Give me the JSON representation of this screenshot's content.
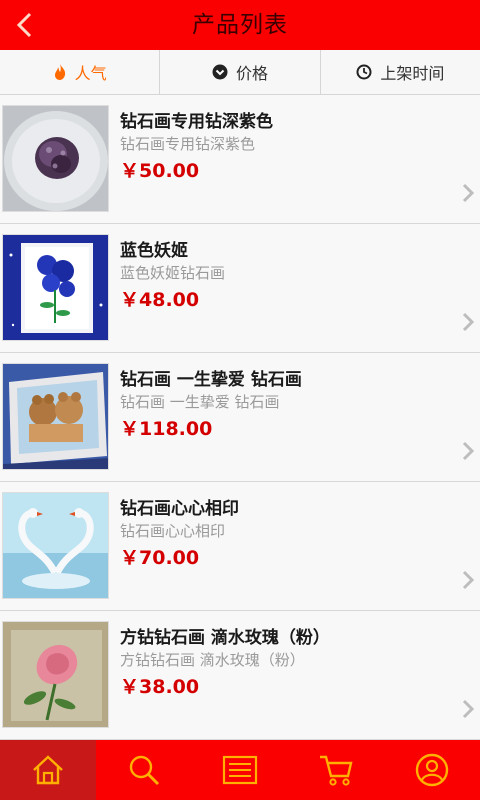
{
  "header": {
    "title": "产品列表"
  },
  "sort_tabs": [
    {
      "label": "人气",
      "icon": "flame-icon",
      "active": true
    },
    {
      "label": "价格",
      "icon": "chevron-down-circle-icon",
      "active": false
    },
    {
      "label": "上架时间",
      "icon": "clock-icon",
      "active": false
    }
  ],
  "products": [
    {
      "name": "钻石画专用钻深紫色",
      "desc": "钻石画专用钻深紫色",
      "price": "￥50.00"
    },
    {
      "name": "蓝色妖姬",
      "desc": "蓝色妖姬钻石画",
      "price": "￥48.00"
    },
    {
      "name": "钻石画 一生挚爱 钻石画",
      "desc": "钻石画 一生挚爱 钻石画",
      "price": "￥118.00"
    },
    {
      "name": "钻石画心心相印",
      "desc": "钻石画心心相印",
      "price": "￥70.00"
    },
    {
      "name": "方钻钻石画 滴水玫瑰（粉）",
      "desc": "方钻钻石画 滴水玫瑰（粉）",
      "price": "￥38.00"
    }
  ],
  "bottom_tabs": [
    "home-icon",
    "search-icon",
    "list-icon",
    "cart-icon",
    "user-icon"
  ],
  "colors": {
    "brand_red": "#fa0000",
    "price_red": "#d40000",
    "active_orange": "#ff6a00"
  }
}
